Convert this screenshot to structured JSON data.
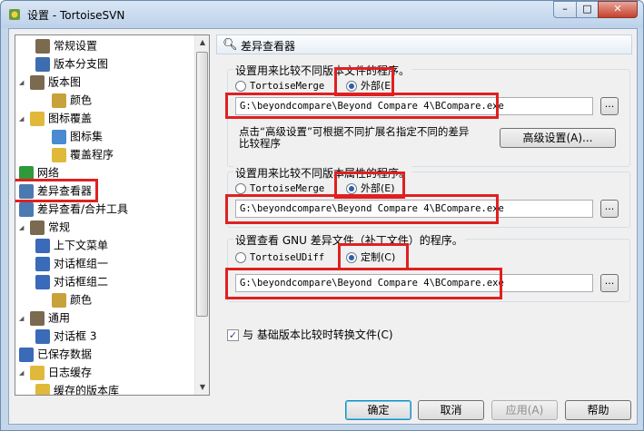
{
  "window": {
    "title": "设置 - TortoiseSVN",
    "min_glyph": "–",
    "max_glyph": "□",
    "close_glyph": "✕"
  },
  "tree": {
    "items": [
      {
        "label": "常规设置",
        "icon": "wrench-icon",
        "color": "#7a6a50"
      },
      {
        "label": "版本分支图",
        "icon": "branch-graph-icon",
        "color": "#3b6db0"
      },
      {
        "label": "版本图",
        "icon": "wrench-icon",
        "color": "#7a6a50"
      },
      {
        "label": "颜色",
        "icon": "palette-icon",
        "color": "#c9a13a"
      },
      {
        "label": "图标覆盖",
        "icon": "overlay-folder-icon",
        "color": "#e0b93a"
      },
      {
        "label": "图标集",
        "icon": "icon-set-icon",
        "color": "#4a8ad0"
      },
      {
        "label": "覆盖程序",
        "icon": "overlay-handler-icon",
        "color": "#e0b93a"
      },
      {
        "label": "网络",
        "icon": "globe-icon",
        "color": "#2e9a3a"
      },
      {
        "label": "差异查看器",
        "icon": "magnifier-icon",
        "color": "#4a7ab0"
      },
      {
        "label": "差异查看/合并工具",
        "icon": "merge-tool-icon",
        "color": "#4a7ab0"
      },
      {
        "label": "常规",
        "icon": "wrench-icon",
        "color": "#7a6a50"
      },
      {
        "label": "上下文菜单",
        "icon": "gear-icon",
        "color": "#3a6ab8"
      },
      {
        "label": "对话框组一",
        "icon": "dialogs-icon",
        "color": "#3a6ab8"
      },
      {
        "label": "对话框组二",
        "icon": "dialogs-icon",
        "color": "#3a6ab8"
      },
      {
        "label": "颜色",
        "icon": "palette-icon",
        "color": "#c9a13a"
      },
      {
        "label": "通用",
        "icon": "wrench-icon",
        "color": "#7a6a50"
      },
      {
        "label": "对话框 3",
        "icon": "dialogs-icon",
        "color": "#3a6ab8"
      },
      {
        "label": "已保存数据",
        "icon": "gear-icon",
        "color": "#3a6ab8"
      },
      {
        "label": "日志缓存",
        "icon": "database-icon",
        "color": "#e0b93a"
      },
      {
        "label": "缓存的版本库",
        "icon": "database-icon",
        "color": "#e0b93a"
      }
    ]
  },
  "panel": {
    "title": "差异查看器",
    "group1": {
      "title": "设置用来比较不同版本文件的程序。",
      "option_internal": "TortoiseMerge",
      "option_external": "外部(E)",
      "path": "G:\\beyondcompare\\Beyond Compare 4\\BCompare.exe",
      "browse": "...",
      "hint": "点击“高级设置”可根据不同扩展名指定不同的差异比较程序",
      "advanced_button": "高级设置(A)..."
    },
    "group2": {
      "title": "设置用来比较不同版本属性的程序。",
      "option_internal": "TortoiseMerge",
      "option_external": "外部(E)",
      "path": "G:\\beyondcompare\\Beyond Compare 4\\BCompare.exe",
      "browse": "..."
    },
    "group3": {
      "title": "设置查看 GNU 差异文件（补丁文件）的程序。",
      "option_internal": "TortoiseUDiff",
      "option_custom": "定制(C)",
      "path": "G:\\beyondcompare\\Beyond Compare 4\\BCompare.exe",
      "browse": "..."
    },
    "checkbox_label": "与 基础版本比较时转换文件(C)"
  },
  "buttons": {
    "ok": "确定",
    "cancel": "取消",
    "apply": "应用(A)",
    "help": "帮助"
  },
  "colors": {
    "highlight": "#e02020",
    "title_bar": "#c4d6ea"
  }
}
